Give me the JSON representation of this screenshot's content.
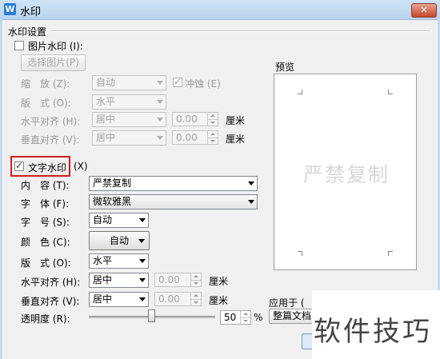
{
  "window": {
    "title": "水印",
    "app_icon_glyph": "W",
    "close_glyph": "✕"
  },
  "section": {
    "title": "水印设置"
  },
  "picture": {
    "checkbox_label": "图片水印",
    "checkbox_hotkey": "(I):",
    "choose_button": "选择图片",
    "choose_hotkey": "(P)",
    "scale_label": "缩　放",
    "scale_hotkey": "(Z):",
    "scale_value": "自动",
    "washout_label": "冲蚀",
    "washout_hotkey": "(E)",
    "layout_label": "版　式",
    "layout_hotkey": "(O):",
    "layout_value": "水平",
    "halign_label": "水平对齐",
    "halign_hotkey": "(H):",
    "halign_value": "居中",
    "halign_offset": "0.00",
    "valign_label": "垂直对齐",
    "valign_hotkey": "(V):",
    "valign_value": "居中",
    "valign_offset": "0.00",
    "unit": "厘米"
  },
  "text": {
    "checkbox_label": "文字水印",
    "checkbox_hotkey": "(X)",
    "content_label": "内　容",
    "content_hotkey": "(T):",
    "content_value": "严禁复制",
    "font_label": "字　体",
    "font_hotkey": "(F):",
    "font_value": "微软雅黑",
    "size_label": "字　号",
    "size_hotkey": "(S):",
    "size_value": "自动",
    "color_label": "颜　色",
    "color_hotkey": "(C):",
    "color_value": "自动",
    "layout_label": "版　式",
    "layout_hotkey": "(O):",
    "layout_value": "水平",
    "halign_label": "水平对齐",
    "halign_hotkey": "(H):",
    "halign_value": "居中",
    "halign_offset": "0.00",
    "valign_label": "垂直对齐",
    "valign_hotkey": "(V):",
    "valign_value": "居中",
    "valign_offset": "0.00",
    "unit": "厘米",
    "transparency_label": "透明度",
    "transparency_hotkey": "(R):",
    "transparency_value": "50",
    "transparency_unit": "%"
  },
  "preview": {
    "label": "预览",
    "watermark_text": "严禁复制"
  },
  "apply": {
    "label": "应用于",
    "hotkey": "(",
    "value": "整篇文档"
  },
  "overlay": {
    "brand": "软件技巧"
  },
  "colors": {
    "highlight": "#d01f1f",
    "titlebar": "#c3daf2"
  }
}
